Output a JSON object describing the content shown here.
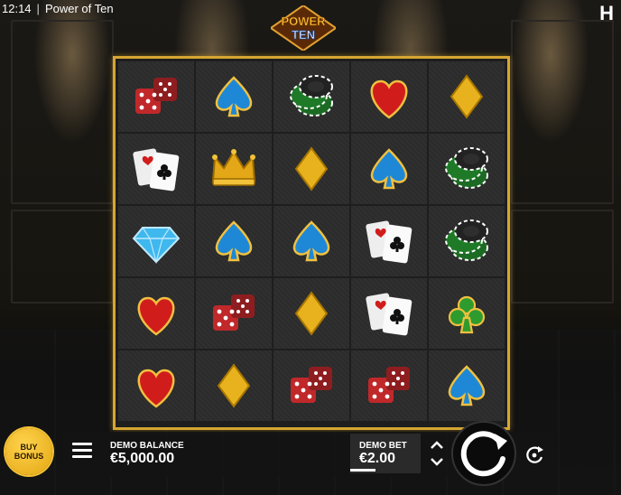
{
  "status_bar": {
    "time": "12:14",
    "separator": "|",
    "app_title": "Power of Ten"
  },
  "brand_logo_text": "H",
  "game_logo": {
    "line1": "POWER",
    "line2": "TEN"
  },
  "reels": {
    "columns": 5,
    "rows": 5,
    "symbols": [
      [
        "dice",
        "spade",
        "chips",
        "heart",
        "diamond"
      ],
      [
        "cards",
        "crown",
        "diamond",
        "spade",
        "chips"
      ],
      [
        "gem",
        "spade",
        "spade",
        "cards",
        "chips"
      ],
      [
        "heart",
        "dice",
        "diamond",
        "cards",
        "club"
      ],
      [
        "heart",
        "diamond",
        "dice",
        "dice",
        "spade"
      ]
    ]
  },
  "buy_bonus": {
    "line1": "BUY",
    "line2": "BONUS"
  },
  "balance": {
    "label": "DEMO BALANCE",
    "value": "€5,000.00"
  },
  "bet": {
    "label": "DEMO BET",
    "value": "€2.00"
  },
  "icons": {
    "menu": "hamburger-menu-icon",
    "bet_up": "chevron-up-icon",
    "bet_down": "chevron-down-icon",
    "spin": "spin-arrow-icon",
    "autoplay": "autoplay-icon"
  },
  "colors": {
    "frame_gold": "#d6a632",
    "buy_bonus": "#f4c234",
    "heart_red": "#d11c1c",
    "spade_blue": "#1e88d6",
    "club_green": "#2e9b2e"
  }
}
